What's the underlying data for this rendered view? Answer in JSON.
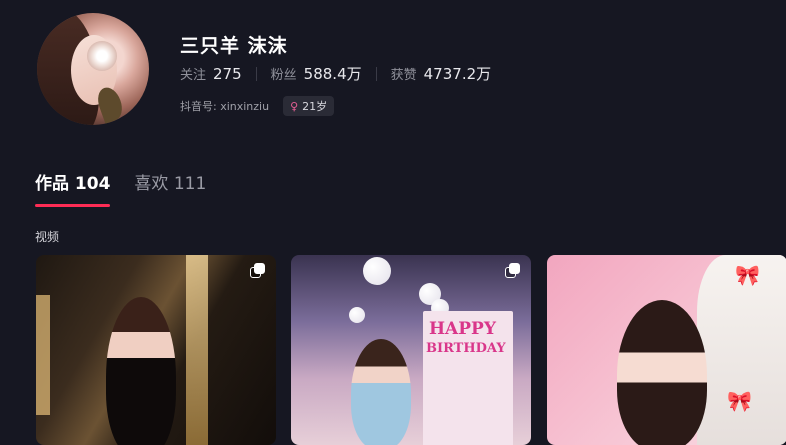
{
  "profile": {
    "name": "三只羊 沫沫",
    "stats": [
      {
        "label": "关注",
        "value": "275"
      },
      {
        "label": "粉丝",
        "value": "588.4万"
      },
      {
        "label": "获赞",
        "value": "4737.2万"
      }
    ],
    "douyin_id": "抖音号: xinxinziu",
    "age": "21岁",
    "gender_icon": "female-icon"
  },
  "tabs": [
    {
      "label": "作品",
      "count": "104",
      "active": true
    },
    {
      "label": "喜欢",
      "count": "111",
      "active": false
    }
  ],
  "section_title": "视频",
  "videos": [
    {
      "type_icon": "multi-image-icon"
    },
    {
      "type_icon": "multi-image-icon",
      "banner_line1": "HAPPY",
      "banner_line2": "BIRTHDAY"
    },
    {
      "type_icon": "none"
    }
  ],
  "colors": {
    "accent": "#fe2c55",
    "background": "#161722",
    "female": "#e95f96"
  }
}
